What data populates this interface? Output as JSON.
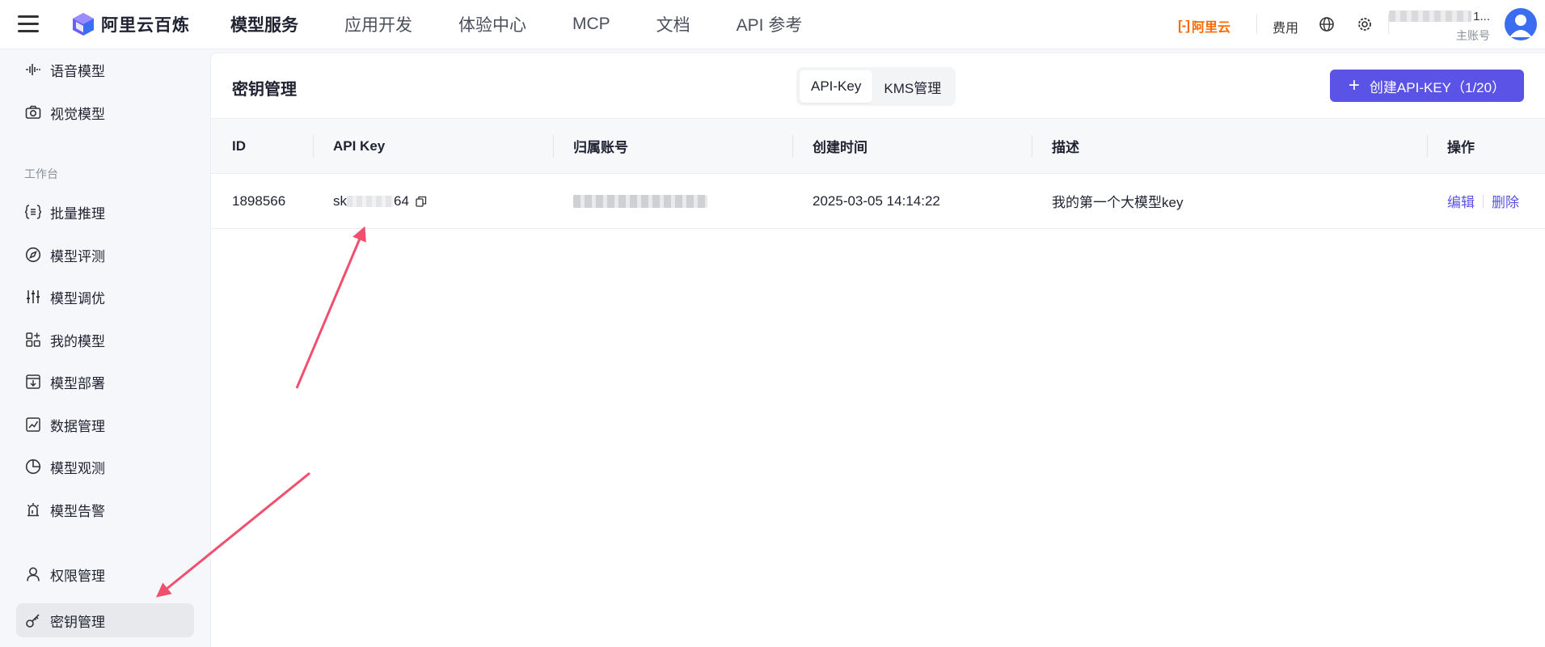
{
  "header": {
    "brand": "阿里云百炼",
    "nav": [
      "模型服务",
      "应用开发",
      "体验中心",
      "MCP",
      "文档",
      "API 参考"
    ],
    "aliyun_logo": "阿里云",
    "fee_label": "费用",
    "account_suffix": "1...",
    "account_role": "主账号"
  },
  "sidebar": {
    "items_top": [
      {
        "label": "语音模型",
        "icon": "waveform-icon"
      },
      {
        "label": "视觉模型",
        "icon": "camera-icon"
      }
    ],
    "section_label": "工作台",
    "items_workbench": [
      {
        "label": "批量推理",
        "icon": "bracket-list-icon"
      },
      {
        "label": "模型评测",
        "icon": "compass-icon"
      },
      {
        "label": "模型调优",
        "icon": "sliders-icon"
      },
      {
        "label": "我的模型",
        "icon": "grid-icon"
      },
      {
        "label": "模型部署",
        "icon": "download-box-icon"
      },
      {
        "label": "数据管理",
        "icon": "chart-line-icon"
      },
      {
        "label": "模型观测",
        "icon": "pie-chart-icon"
      },
      {
        "label": "模型告警",
        "icon": "alarm-icon"
      }
    ],
    "items_bottom": [
      {
        "label": "权限管理",
        "icon": "user-icon"
      },
      {
        "label": "密钥管理",
        "icon": "key-icon",
        "active": true
      }
    ]
  },
  "main": {
    "title": "密钥管理",
    "tabs": [
      "API-Key",
      "KMS管理"
    ],
    "active_tab": "API-Key",
    "create_button": "创建API-KEY（1/20）",
    "table": {
      "headers": [
        "ID",
        "API Key",
        "归属账号",
        "创建时间",
        "描述",
        "操作"
      ],
      "rows": [
        {
          "id": "1898566",
          "key_prefix": "sk",
          "key_suffix": "64",
          "created": "2025-03-05 14:14:22",
          "description": "我的第一个大模型key",
          "actions": [
            "编辑",
            "删除"
          ]
        }
      ]
    }
  },
  "colors": {
    "accent": "#5b52e6",
    "aliyun_orange": "#ff6a00",
    "annotation_arrow": "#f0506e"
  }
}
